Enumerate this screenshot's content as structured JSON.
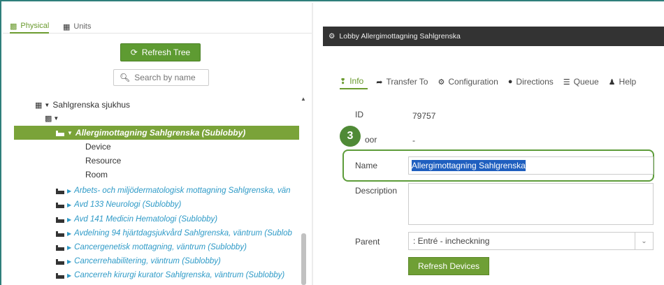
{
  "left_tabs": [
    {
      "label": "Physical",
      "icon": "building-icon",
      "active": true
    },
    {
      "label": "Units",
      "icon": "grid-icon",
      "active": false
    }
  ],
  "refresh_tree_label": "Refresh Tree",
  "search_placeholder": "Search by name",
  "tree": {
    "root_label": "Sahlgrenska sjukhus",
    "selected_label": "Allergimottagning Sahlgrenska (Sublobby)",
    "children": [
      "Device",
      "Resource",
      "Room"
    ],
    "items": [
      "Arbets- och miljödermatologisk mottagning Sahlgrenska, vän",
      "Avd 133 Neurologi (Sublobby)",
      "Avd 141 Medicin Hematologi (Sublobby)",
      "Avdelning 94 hjärtdagsjukvård Sahlgrenska, väntrum (Sublob",
      "Cancergenetisk mottagning, väntrum (Sublobby)",
      "Cancerrehabilitering, väntrum (Sublobby)",
      "Cancerreh kirurgi kurator Sahlgrenska, väntrum (Sublobby)"
    ]
  },
  "detail": {
    "title": "Lobby Allergimottagning Sahlgrenska",
    "tabs": [
      {
        "label": "Info",
        "icon": "info-icon",
        "active": true
      },
      {
        "label": "Transfer To",
        "icon": "share-arrow-icon",
        "active": false
      },
      {
        "label": "Configuration",
        "icon": "gears-icon",
        "active": false
      },
      {
        "label": "Directions",
        "icon": "map-marker-icon",
        "active": false
      },
      {
        "label": "Queue",
        "icon": "list-icon",
        "active": false
      },
      {
        "label": "Help",
        "icon": "user-icon",
        "active": false
      }
    ],
    "fields": {
      "id_label": "ID",
      "id_value": "79757",
      "floor_label": "oor",
      "floor_value": "-",
      "name_label": "Name",
      "name_value": "Allergimottagning Sahlgrenska",
      "description_label": "Description",
      "parent_label": "Parent",
      "parent_value": ": Entré - incheckning"
    },
    "refresh_devices_label": "Refresh Devices",
    "step_badge": "3"
  },
  "colors": {
    "accent_green": "#6b9b2f",
    "badge_green": "#4f8a36",
    "link_blue": "#2e9ac7",
    "selection_blue": "#1f5fbf"
  }
}
